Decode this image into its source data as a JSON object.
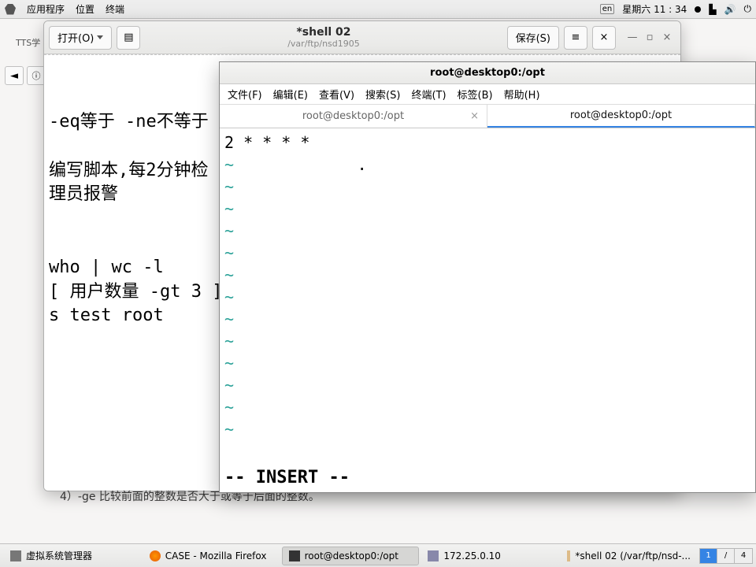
{
  "top_panel": {
    "apps": "应用程序",
    "places": "位置",
    "terminal": "终端",
    "date": "星期六 11 : 34"
  },
  "browser": {
    "tab": "TTS学"
  },
  "gedit": {
    "open": "打开(O)",
    "save": "保存(S)",
    "title": "*shell 02",
    "path": "/var/ftp/nsd1905",
    "text_lines": {
      "l1": "-eq等于 -ne不等于",
      "l2": "编写脚本,每2分钟检",
      "l3": "理员报警",
      "l4": "who | wc -l",
      "l5": "[ 用户数量 -gt 3 ]",
      "l6": "s test root"
    }
  },
  "page_frag": "4）-ge 比较前面的整数是否大于或等于后面的整数。",
  "terminal": {
    "title": "root@desktop0:/opt",
    "menu": {
      "file": "文件(F)",
      "edit": "编辑(E)",
      "view": "查看(V)",
      "search": "搜索(S)",
      "term": "终端(T)",
      "tabs": "标签(B)",
      "help": "帮助(H)"
    },
    "tabs": {
      "t1": "root@desktop0:/opt",
      "t2": "root@desktop0:/opt"
    },
    "content": "2 * * * *",
    "tilde": "~",
    "status": "-- INSERT --"
  },
  "taskbar": {
    "items": {
      "i1": "虚拟系统管理器",
      "i2": "CASE - Mozilla Firefox",
      "i3": "root@desktop0:/opt",
      "i4": "172.25.0.10",
      "i5": "*shell 02 (/var/ftp/nsd-..."
    },
    "pager": {
      "a": "1",
      "b": "4"
    }
  }
}
